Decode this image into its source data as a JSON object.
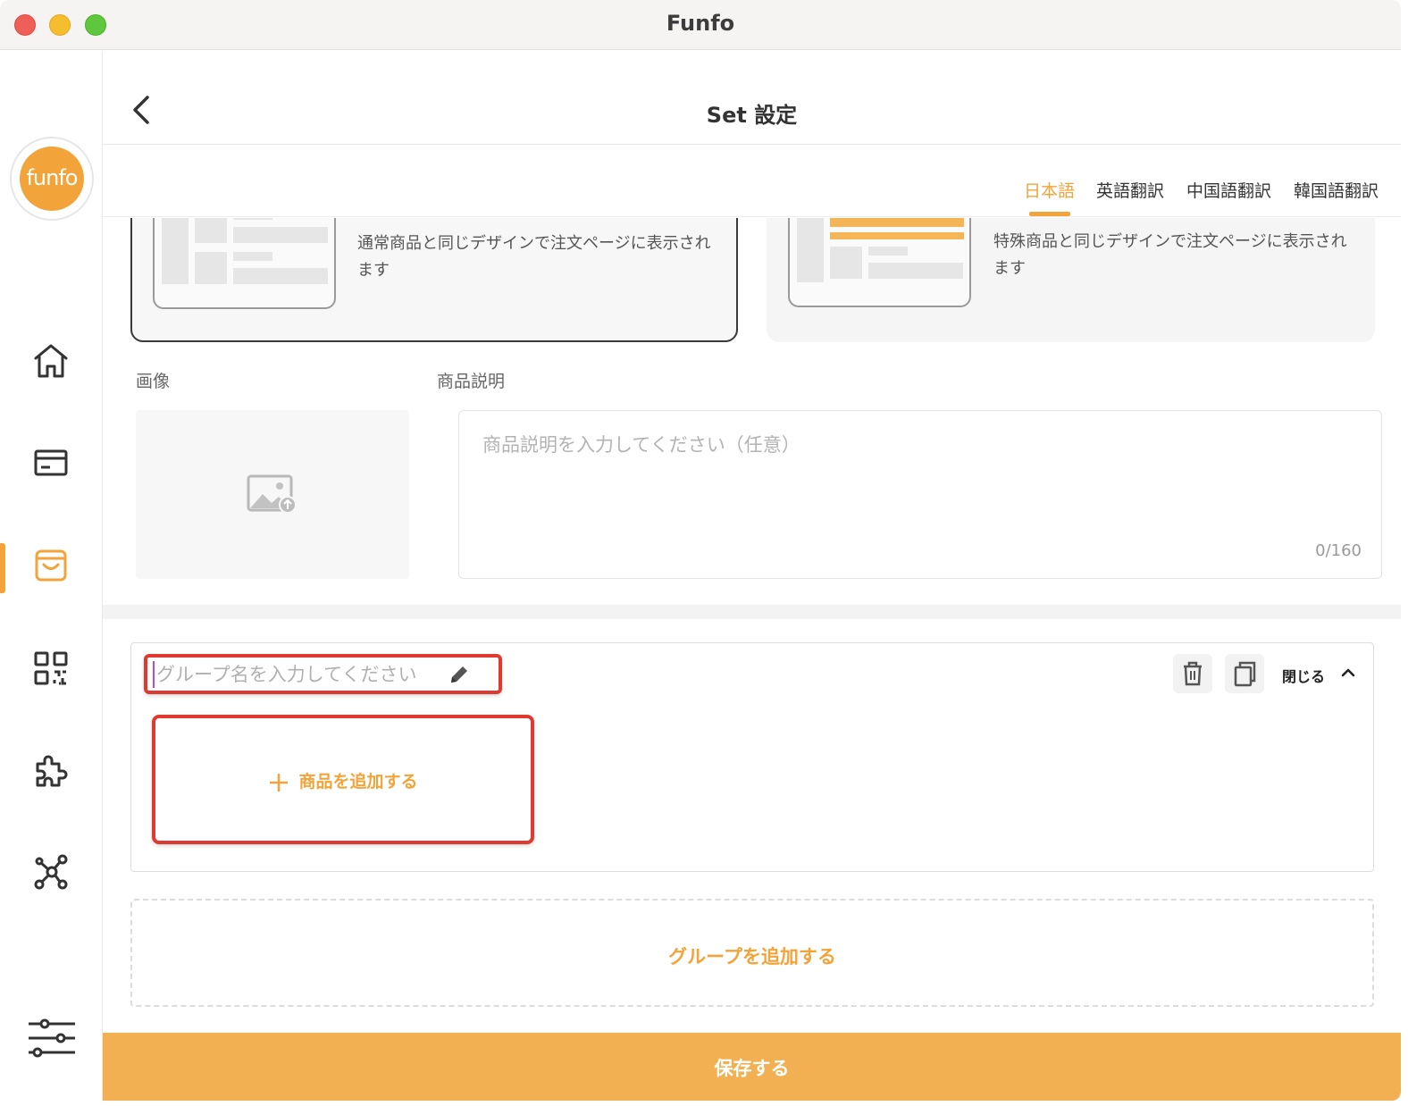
{
  "window": {
    "title": "Funfo"
  },
  "brand": {
    "logo_text": "funfo",
    "accent": "#f2a339"
  },
  "sidebar": {
    "items": [
      {
        "icon": "home-icon"
      },
      {
        "icon": "card-icon"
      },
      {
        "icon": "shopping-bag-icon",
        "active": true
      },
      {
        "icon": "qr-code-icon"
      },
      {
        "icon": "puzzle-icon"
      },
      {
        "icon": "share-network-icon"
      },
      {
        "icon": "sliders-icon"
      }
    ]
  },
  "header": {
    "title": "Set 設定"
  },
  "languages": {
    "tabs": [
      "日本語",
      "英語翻訳",
      "中国語翻訳",
      "韓国語翻訳"
    ],
    "active": "日本語"
  },
  "design_options": {
    "normal": {
      "description": "通常商品と同じデザインで注文ページに表示されます",
      "selected": true
    },
    "special": {
      "description": "特殊商品と同じデザインで注文ページに表示されます",
      "selected": false
    }
  },
  "form": {
    "image_label": "画像",
    "description_label": "商品説明",
    "description_placeholder": "商品説明を入力してください（任意）",
    "description_counter": "0/160"
  },
  "group": {
    "name_placeholder": "グループ名を入力してください",
    "close_label": "閉じる",
    "add_item_label": "商品を追加する"
  },
  "add_group_label": "グループを追加する",
  "save_label": "保存する"
}
